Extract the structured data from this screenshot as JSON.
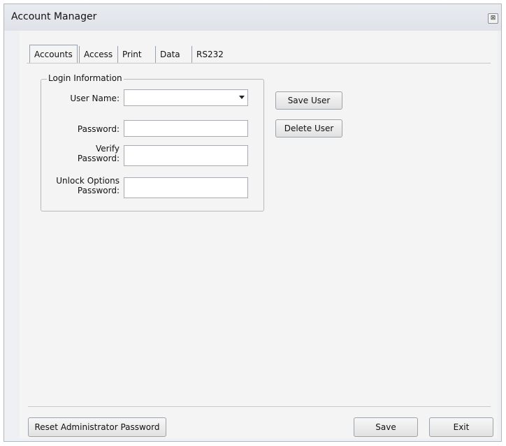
{
  "window": {
    "title": "Account Manager",
    "close_glyph": "⊠"
  },
  "tabs": [
    {
      "label": "Accounts",
      "active": true
    },
    {
      "label": "Access",
      "active": false
    },
    {
      "label": "Print",
      "active": false
    },
    {
      "label": "Data",
      "active": false
    },
    {
      "label": "RS232",
      "active": false
    }
  ],
  "login_group": {
    "title": "Login Information",
    "user_name_label": "User Name:",
    "user_name_value": "",
    "password_label": "Password:",
    "password_value": "",
    "verify_label_line1": "Verify",
    "verify_label_line2": "Password:",
    "verify_value": "",
    "unlock_label_line1": "Unlock Options",
    "unlock_label_line2": "Password:",
    "unlock_value": ""
  },
  "buttons": {
    "save_user": "Save User",
    "delete_user": "Delete User",
    "reset_admin": "Reset Administrator Password",
    "save": "Save",
    "exit": "Exit"
  }
}
